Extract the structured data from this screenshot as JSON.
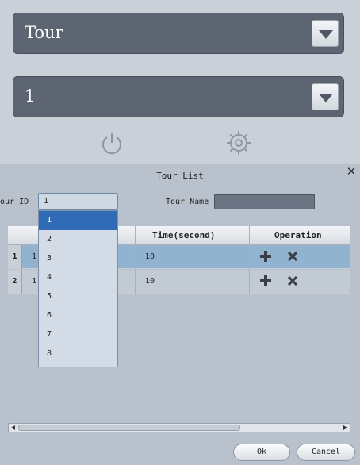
{
  "top": {
    "mode_select": {
      "value": "Tour"
    },
    "number_select": {
      "value": "1"
    },
    "icons": [
      "power-icon",
      "gear-icon"
    ]
  },
  "dialog": {
    "title": "Tour List",
    "close_glyph": "✕",
    "tour_id_label": "our ID",
    "tour_id_value": "1",
    "tour_name_label": "Tour Name",
    "tour_name_value": "",
    "dropdown_options": [
      "1",
      "2",
      "3",
      "4",
      "5",
      "6",
      "7",
      "8"
    ],
    "table": {
      "columns": [
        "",
        "Time(second)",
        "Operation"
      ],
      "rows": [
        {
          "num": "1",
          "id": "1",
          "time": "10"
        },
        {
          "num": "2",
          "id": "1",
          "time": "10"
        }
      ]
    },
    "buttons": {
      "ok": "Ok",
      "cancel": "Cancel"
    }
  },
  "colors": {
    "panel_bg": "#c9d0d8",
    "combo_bg": "#5d6573",
    "dialog_bg": "#b9c2cc",
    "selected_row": "#92b3cf",
    "dropdown_highlight": "#2f6cb5"
  }
}
